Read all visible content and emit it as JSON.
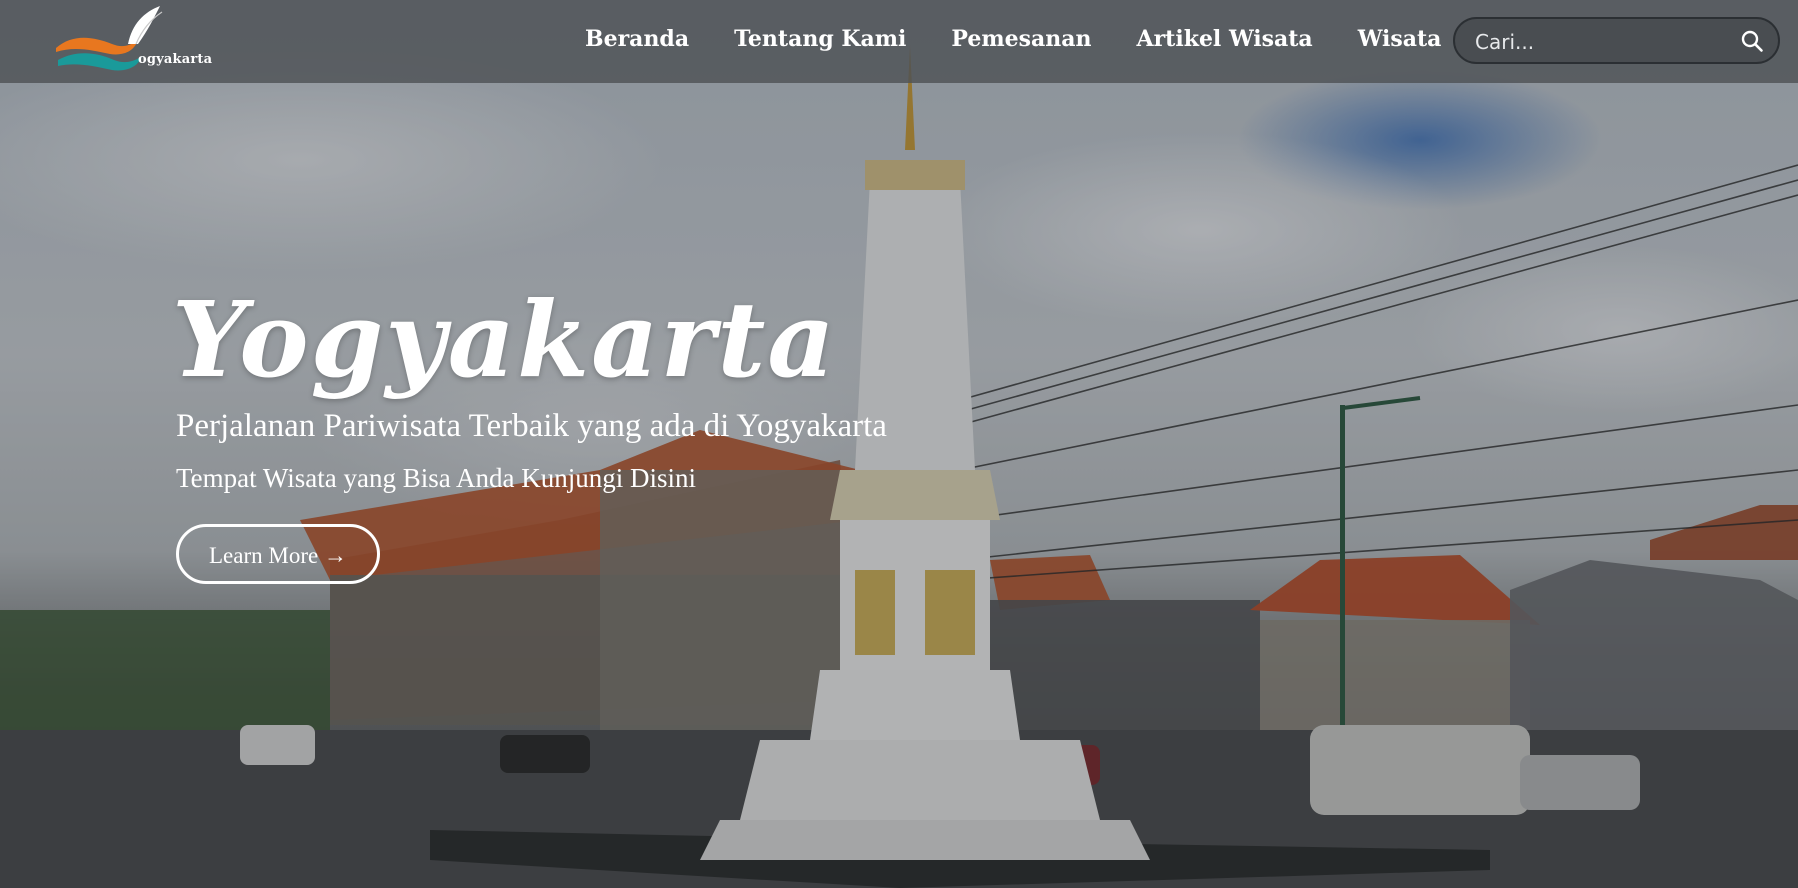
{
  "nav": {
    "logo_text": "ogyakarta",
    "links": [
      {
        "label": "Beranda"
      },
      {
        "label": "Tentang Kami"
      },
      {
        "label": "Pemesanan"
      },
      {
        "label": "Artikel Wisata"
      },
      {
        "label": "Wisata"
      }
    ],
    "search": {
      "placeholder": "Cari...",
      "value": "",
      "icon": "search-icon"
    }
  },
  "hero": {
    "title": "Yogyakarta",
    "subtitle": "Perjalanan Pariwisata Terbaik yang ada di Yogyakarta",
    "tagline": "Tempat Wisata yang Bisa Anda Kunjungi Disini",
    "cta_label": "Learn More →"
  },
  "colors": {
    "navbar_bg": "#4e5256",
    "text": "#ffffff",
    "logo_orange": "#e8771f",
    "logo_teal": "#1a9a9a"
  }
}
